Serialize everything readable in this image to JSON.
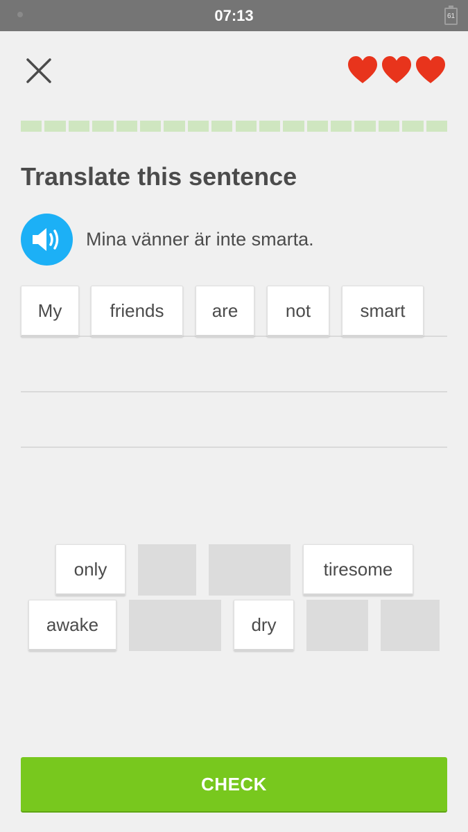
{
  "status_bar": {
    "time": "07:13",
    "battery_label": "61"
  },
  "header": {
    "close_icon": "close-icon",
    "hearts": {
      "count": 3,
      "color": "#e8341c",
      "icon": "heart-icon"
    },
    "progress": {
      "segments": 18,
      "completed": 0,
      "track_color": "#cfe6c0"
    }
  },
  "prompt": {
    "title": "Translate this sentence",
    "speaker_icon": "speaker-icon",
    "sentence": "Mina vänner är inte smarta."
  },
  "answer": {
    "selected_tiles": [
      "My",
      "friends",
      "are",
      "not",
      "smart"
    ]
  },
  "word_bank": {
    "row1": [
      {
        "label": "only",
        "used": false
      },
      {
        "label": "",
        "used": true
      },
      {
        "label": "",
        "used": true
      },
      {
        "label": "tiresome",
        "used": false
      }
    ],
    "row2": [
      {
        "label": "awake",
        "used": false
      },
      {
        "label": "",
        "used": true
      },
      {
        "label": "dry",
        "used": false
      },
      {
        "label": "",
        "used": true
      },
      {
        "label": "",
        "used": true
      }
    ]
  },
  "footer": {
    "check_label": "CHECK",
    "accent": "#78c81e"
  }
}
